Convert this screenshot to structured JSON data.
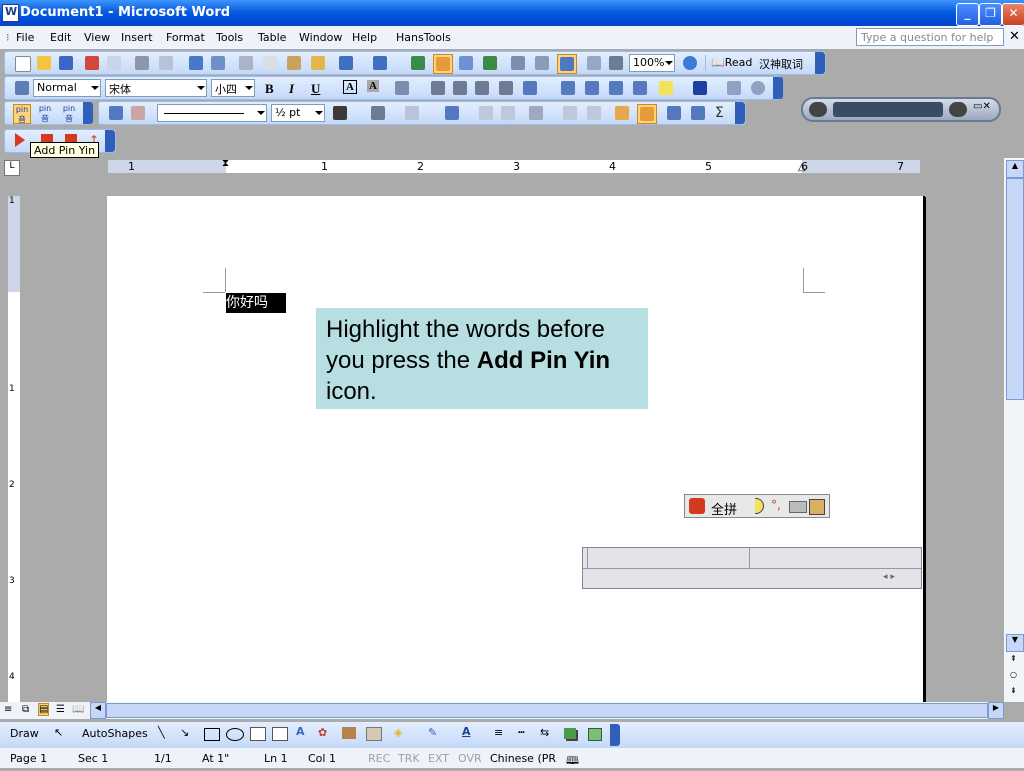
{
  "window": {
    "title": "Document1 - Microsoft Word"
  },
  "menus": [
    "File",
    "Edit",
    "View",
    "Insert",
    "Format",
    "Tools",
    "Table",
    "Window",
    "Help",
    "HansTools"
  ],
  "help_placeholder": "Type a question for help",
  "toolbar_standard": {
    "zoom": "100%",
    "read_label": "Read",
    "chinese_label": "汉神取词"
  },
  "toolbar_format": {
    "style": "Normal",
    "font": "宋体",
    "size": "小四"
  },
  "toolbar_tables": {
    "line_weight": "½ pt"
  },
  "tooltip": "Add Pin Yin",
  "document": {
    "selected_text": "你好吗"
  },
  "callout": {
    "line1": "Highlight the words before",
    "line2_a": "you press the ",
    "line2_b": "Add Pin Yin",
    "line3": "icon."
  },
  "ime_bar": {
    "mode": "全拼"
  },
  "ruler_ticks": [
    "1",
    "1",
    "2",
    "3",
    "4",
    "5",
    "6",
    "7"
  ],
  "vruler_ticks": [
    "1",
    "1",
    "2",
    "3",
    "4"
  ],
  "drawbar": {
    "draw_label": "Draw",
    "autoshapes_label": "AutoShapes"
  },
  "status": {
    "page": "Page 1",
    "sec": "Sec 1",
    "pages": "1/1",
    "at": "At 1\"",
    "ln": "Ln 1",
    "col": "Col 1",
    "rec": "REC",
    "trk": "TRK",
    "ext": "EXT",
    "ovr": "OVR",
    "lang": "Chinese (PR"
  },
  "colors": {
    "title_blue": "#0054E3",
    "callout_bg": "#B7DFE2",
    "toolbar_bg": "#C4D9F8",
    "gray_bg": "#ABABAB"
  }
}
